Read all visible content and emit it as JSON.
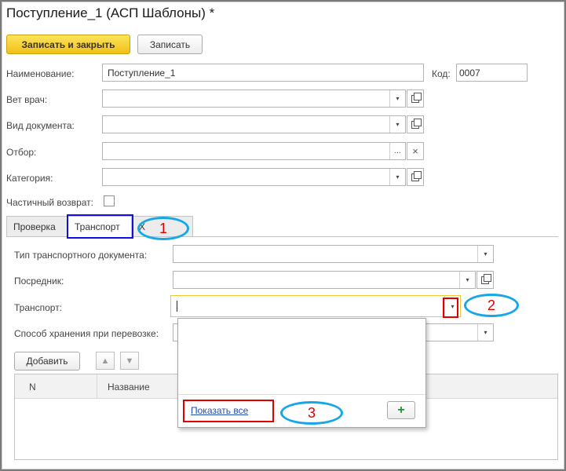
{
  "window": {
    "title": "Поступление_1 (АСП Шаблоны) *"
  },
  "toolbar": {
    "save_close_label": "Записать и закрыть",
    "save_label": "Записать"
  },
  "form": {
    "name_label": "Наименование:",
    "name_value": "Поступление_1",
    "code_label": "Код:",
    "code_value": "0007",
    "vet_label": "Вет врач:",
    "doc_type_label": "Вид документа:",
    "filter_label": "Отбор:",
    "category_label": "Категория:",
    "partial_return_label": "Частичный возврат:"
  },
  "tabs": [
    {
      "label": "Проверка"
    },
    {
      "label": "Транспорт"
    },
    {
      "label": "Х"
    }
  ],
  "transport": {
    "doc_type_label": "Тип транспортного документа:",
    "intermediary_label": "Посредник:",
    "transport_label": "Транспорт:",
    "storage_label": "Способ хранения при перевозке:",
    "add_label": "Добавить"
  },
  "table": {
    "columns": [
      "N",
      "Название"
    ]
  },
  "popup": {
    "show_all_label": "Показать все",
    "create_label": "+"
  },
  "annotations": {
    "one": "1",
    "two": "2",
    "three": "3"
  },
  "icons": {
    "dropdown": "▾",
    "clear": "×",
    "ellipsis": "...",
    "up": "▲",
    "down": "▼"
  },
  "colors": {
    "primary_button": "#f2c014",
    "annotation_red": "#e00000",
    "annotation_blue": "#1010e6",
    "annotation_cyan": "#16a8e6",
    "create_plus": "#1e9a2a"
  }
}
